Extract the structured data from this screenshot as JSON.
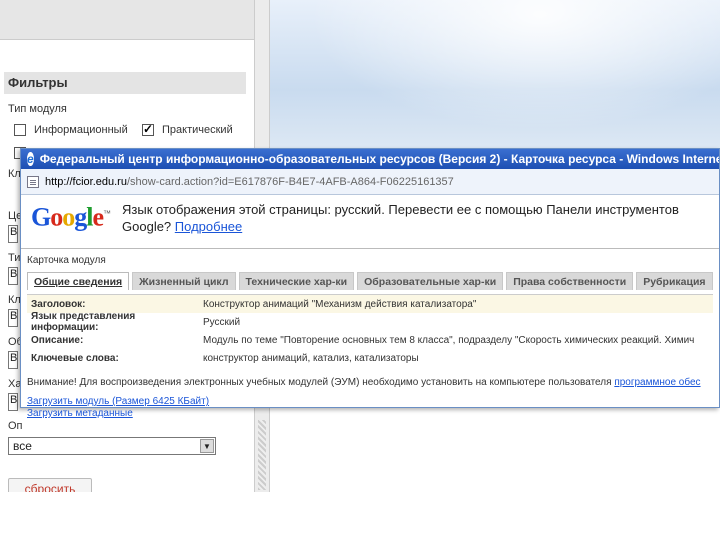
{
  "filters": {
    "heading": "Фильтры",
    "module_type_label": "Тип модуля",
    "checkboxes": [
      {
        "label": "Информационный",
        "checked": false
      },
      {
        "label": "Практический",
        "checked": true
      }
    ],
    "stubs": [
      "Кл",
      "Це",
      "Ти",
      "Кл",
      "Об",
      "Ха",
      "Оп"
    ],
    "stub_value": "В",
    "select_value": "все",
    "reset_label": "сбросить"
  },
  "ie": {
    "title": "Федеральный центр информационно-образовательных ресурсов (Версия 2) - Карточка ресурса - Windows Internet Exp",
    "logo_letter": "e",
    "url_host": "http://fcior.edu.ru",
    "url_path": "/show-card.action?id=E617876F-B4E7-4AFB-A864-F06225161357"
  },
  "google_bar": {
    "logo_letters": [
      "G",
      "o",
      "o",
      "g",
      "l",
      "e"
    ],
    "logo_tm": "™",
    "message_line1": "Язык отображения этой страницы: русский. Перевести ее с помощью Панели инструментов",
    "message_line2": "Google?",
    "more_link": "Подробнее"
  },
  "card": {
    "title": "Карточка модуля",
    "tabs": [
      "Общие сведения",
      "Жизненный цикл",
      "Технические хар-ки",
      "Образовательные хар-ки",
      "Права собственности",
      "Рубрикация"
    ],
    "active_tab": 0,
    "fields": [
      {
        "key": "Заголовок:",
        "value": "Конструктор анимаций \"Механизм действия катализатора\""
      },
      {
        "key": "Язык представления информации:",
        "value": "Русский"
      },
      {
        "key": "Описание:",
        "value": "Модуль по теме \"Повторение основных тем 8 класса\", подразделу \"Скорость химических реакций. Химич"
      },
      {
        "key": "Ключевые слова:",
        "value": "конструктор анимаций, катализ, катализаторы"
      }
    ],
    "notice_text": "Внимание! Для воспроизведения электронных учебных модулей (ЭУМ) необходимо установить на компьютере пользователя ",
    "notice_link": "программное обес",
    "download_module": "Загрузить модуль (Размер 6425 КБайт)",
    "download_meta": "Загрузить метаданные"
  }
}
